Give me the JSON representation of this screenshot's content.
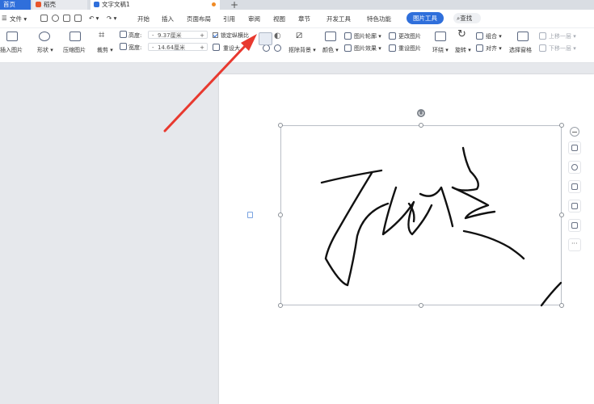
{
  "tabs": {
    "home": "首页",
    "daoke": "稻壳",
    "doc": "文字文稿1"
  },
  "menu": {
    "file": "文件",
    "items": [
      "开始",
      "插入",
      "页面布局",
      "引用",
      "审阅",
      "视图",
      "章节",
      "开发工具",
      "特色功能"
    ],
    "active": "图片工具",
    "search": "查找"
  },
  "ribbon": {
    "insert_image": "插入图片",
    "shape": "形状",
    "compress": "压缩图片",
    "crop": "裁剪",
    "height_label": "高度:",
    "height_value": "9.37厘米",
    "width_label": "宽度:",
    "width_value": "14.64厘米",
    "lock_ratio": "锁定纵横比",
    "reset_size": "重设大",
    "remove_bg": "抠除背景",
    "color": "颜色",
    "outline": "图片轮廓",
    "effects": "图片效果",
    "change_image": "更改图片",
    "reset_image": "重设图片",
    "wrap": "环绕",
    "rotate": "旋转",
    "group": "组合",
    "align": "对齐",
    "selection_pane": "选择窗格",
    "bring_forward": "上移一层",
    "send_backward": "下移一层"
  },
  "colors": {
    "accent": "#2f6fdb",
    "arrow": "#e8392f",
    "ink": "#111111"
  }
}
